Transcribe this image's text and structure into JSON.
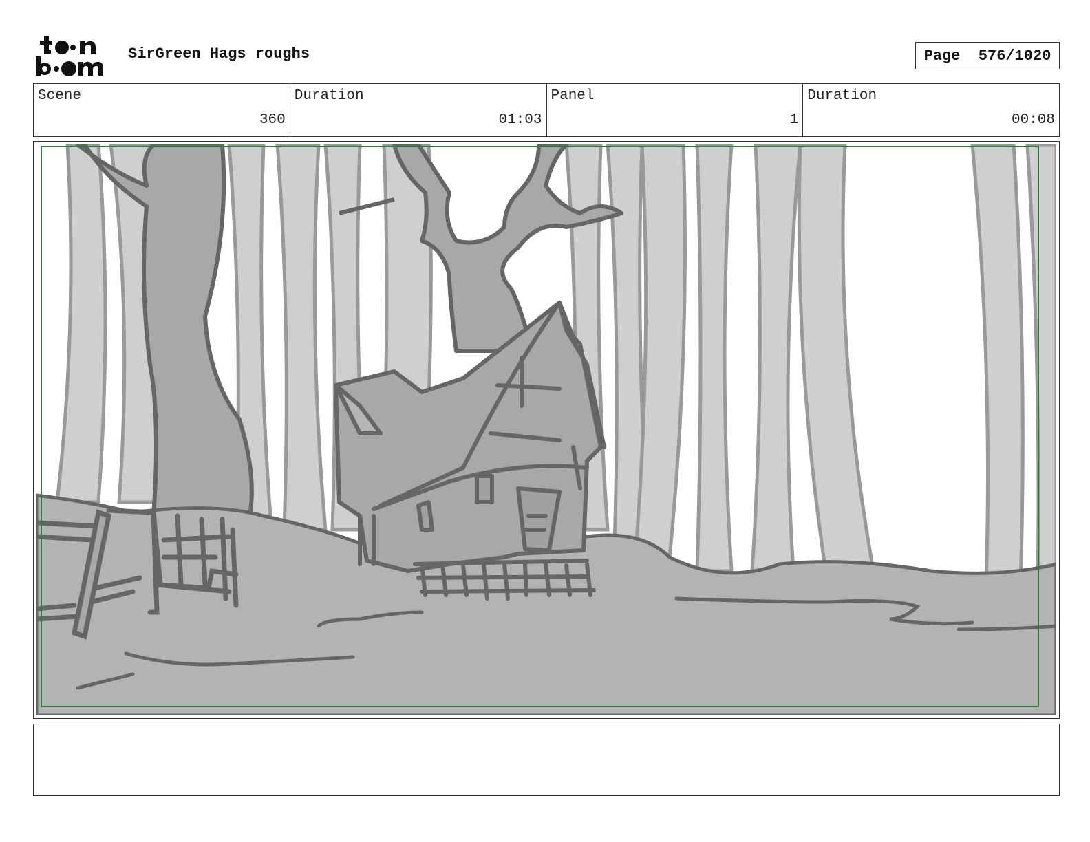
{
  "header": {
    "logo_text": "toon boom",
    "project_title": "SirGreen Hags roughs",
    "page_label": "Page",
    "page_number": "576/1020"
  },
  "info": {
    "scene_label": "Scene",
    "scene_value": "360",
    "scene_duration_label": "Duration",
    "scene_duration_value": "01:03",
    "panel_label": "Panel",
    "panel_value": "1",
    "panel_duration_label": "Duration",
    "panel_duration_value": "00:08"
  },
  "colors": {
    "safe_frame": "#2e7d32",
    "ground": "#b3b3b3",
    "tree_light": "#cfcfcf",
    "line_dark": "#666666"
  },
  "notes": {
    "text": ""
  }
}
